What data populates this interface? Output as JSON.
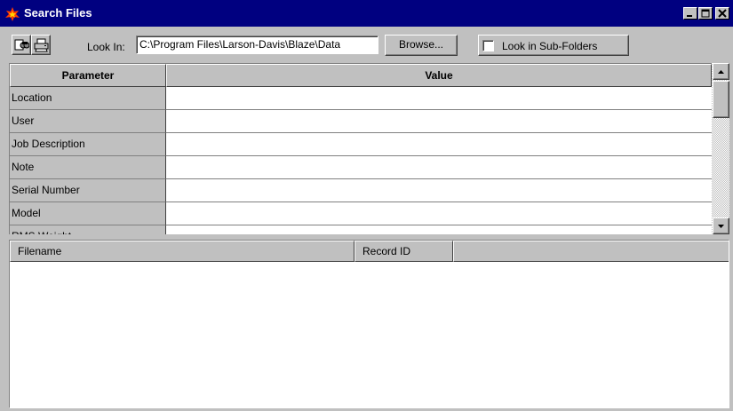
{
  "window": {
    "title": "Search Files",
    "controls": [
      "minimize-icon",
      "maximize-icon",
      "close-icon"
    ]
  },
  "toolbar": {
    "search_icon": "find-icon",
    "print_icon": "printer-icon",
    "look_in_label": "Look In:",
    "look_in_value": "C:\\Program Files\\Larson-Davis\\Blaze\\Data",
    "browse_label": "Browse...",
    "subfolders_label": "Look in Sub-Folders",
    "subfolders_checked": false
  },
  "grid": {
    "headers": [
      "Parameter",
      "Value"
    ],
    "rows": [
      {
        "parameter": "Location",
        "value": ""
      },
      {
        "parameter": "User",
        "value": ""
      },
      {
        "parameter": "Job Description",
        "value": ""
      },
      {
        "parameter": "Note",
        "value": ""
      },
      {
        "parameter": "Serial Number",
        "value": ""
      },
      {
        "parameter": "Model",
        "value": ""
      },
      {
        "parameter": "RMS Weight",
        "value": ""
      }
    ]
  },
  "results": {
    "headers": [
      "Filename",
      "Record ID",
      ""
    ]
  },
  "colors": {
    "title_bar": "#000080",
    "face": "#c0c0c0",
    "window_bg": "#ffffff"
  }
}
